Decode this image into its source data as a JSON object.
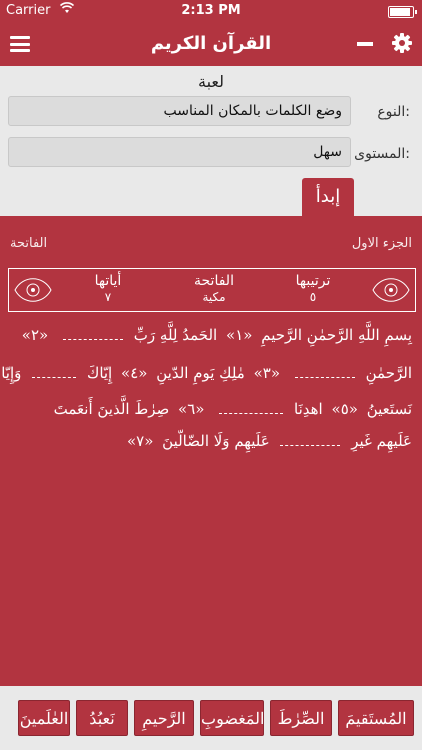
{
  "status_bar": {
    "carrier": "Carrier",
    "time": "2:13 PM"
  },
  "nav": {
    "title": "القرآن الكريم"
  },
  "settings": {
    "heading": "لعبة",
    "type_label": "النوع:",
    "type_value": "وضع الكلمات بالمكان المناسب",
    "level_label": "المستوى:",
    "level_value": "سهل",
    "start_label": "إبدأ"
  },
  "surah": {
    "juz": "الجزء الاول",
    "name_top": "الفاتحة",
    "order_label": "ترتيبها",
    "order_value": "٥",
    "name": "الفاتحة",
    "type": "مكية",
    "ayat_label": "أياتها",
    "ayat_value": "٧"
  },
  "verses": {
    "l1a": "بِسمِ اللَّهِ الرَّحمٰنِ الرَّحيمِ",
    "m1": "«١»",
    "l1b": "الحَمدُ لِلَّهِ رَبِّ",
    "m2": "«٢»",
    "l2a": "الرَّحمٰنِ",
    "m3": "«٣»",
    "l2b": "مٰلِكِ يَومِ الدّينِ",
    "m4": "«٤»",
    "l2c": "إِيّاكَ",
    "l2d": "وَإِيّاكَ",
    "l3a": "نَستَعينُ",
    "m5": "«٥»",
    "l3b": "اهدِنَا",
    "m6": "«٦»",
    "l3c": "صِرٰطَ الَّذينَ أَنعَمتَ",
    "l4a": "عَلَيهِم غَيرِ",
    "l4b": "عَلَيهِم وَلَا الضّالّينَ",
    "m7": "«٧»"
  },
  "word_bank": [
    "المُستَقيمَ",
    "الصِّرٰطَ",
    "المَغضوبِ",
    "الرَّحيمِ",
    "نَعبُدُ",
    "العٰلَمينَ"
  ]
}
